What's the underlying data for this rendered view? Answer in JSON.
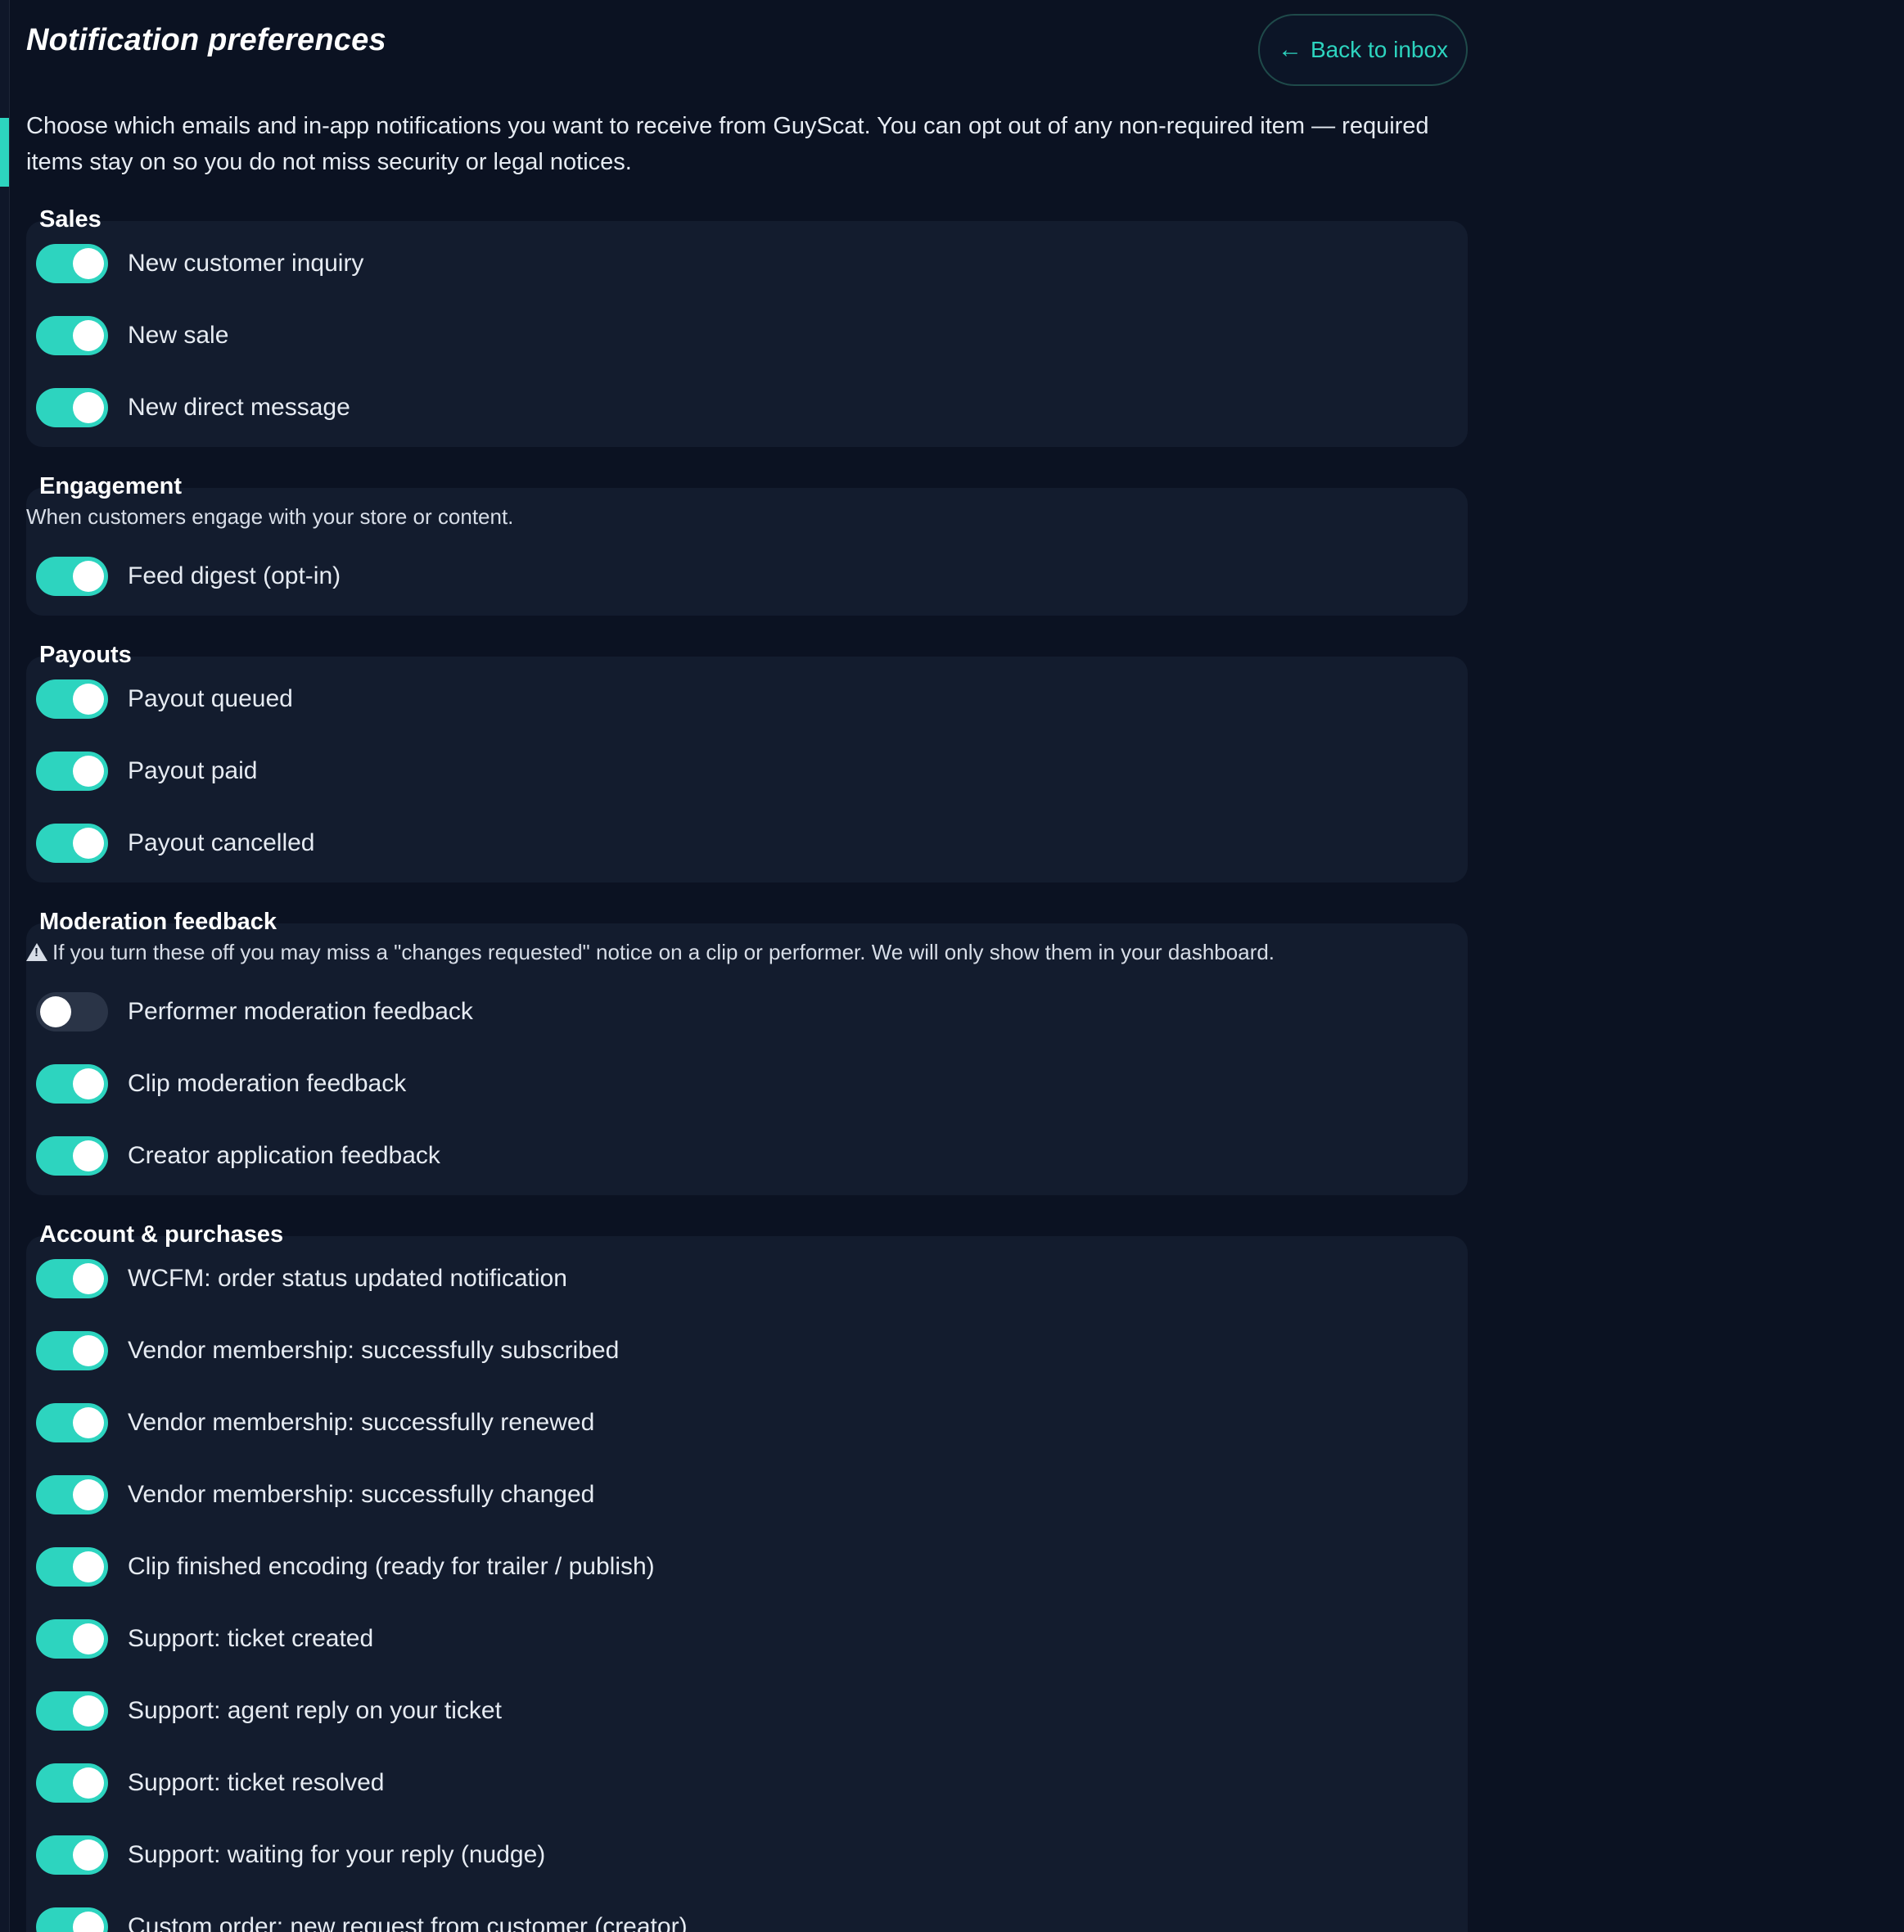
{
  "page": {
    "title": "Notification preferences",
    "back_button_icon": "arrow-left-icon",
    "back_button_label": "Back to inbox",
    "intro": "Choose which emails and in-app notifications you want to receive from GuyScat. You can opt out of any non-required item — required items stay on so you do not miss security or legal notices."
  },
  "colors": {
    "accent": "#2dd4bf",
    "background": "#0b1222",
    "card": "#131c2e",
    "toggle_off": "#2a3447"
  },
  "sections": {
    "sales": {
      "title": "Sales",
      "items": [
        {
          "label": "New customer inquiry",
          "enabled": true
        },
        {
          "label": "New sale",
          "enabled": true
        },
        {
          "label": "New direct message",
          "enabled": true
        }
      ]
    },
    "engagement": {
      "title": "Engagement",
      "description": "When customers engage with your store or content.",
      "items": [
        {
          "label": "Feed digest (opt-in)",
          "enabled": true
        }
      ]
    },
    "payouts": {
      "title": "Payouts",
      "items": [
        {
          "label": "Payout queued",
          "enabled": true
        },
        {
          "label": "Payout paid",
          "enabled": true
        },
        {
          "label": "Payout cancelled",
          "enabled": true
        }
      ]
    },
    "moderation": {
      "title": "Moderation feedback",
      "warning_icon": "warning-icon",
      "description": "If you turn these off you may miss a \"changes requested\" notice on a clip or performer. We will only show them in your dashboard.",
      "items": [
        {
          "label": "Performer moderation feedback",
          "enabled": false
        },
        {
          "label": "Clip moderation feedback",
          "enabled": true
        },
        {
          "label": "Creator application feedback",
          "enabled": true
        }
      ]
    },
    "account": {
      "title": "Account & purchases",
      "items": [
        {
          "label": "WCFM: order status updated notification",
          "enabled": true
        },
        {
          "label": "Vendor membership: successfully subscribed",
          "enabled": true
        },
        {
          "label": "Vendor membership: successfully renewed",
          "enabled": true
        },
        {
          "label": "Vendor membership: successfully changed",
          "enabled": true
        },
        {
          "label": "Clip finished encoding (ready for trailer / publish)",
          "enabled": true
        },
        {
          "label": "Support: ticket created",
          "enabled": true
        },
        {
          "label": "Support: agent reply on your ticket",
          "enabled": true
        },
        {
          "label": "Support: ticket resolved",
          "enabled": true
        },
        {
          "label": "Support: waiting for your reply (nudge)",
          "enabled": true
        },
        {
          "label": "Custom order: new request from customer (creator)",
          "enabled": true
        }
      ]
    }
  }
}
